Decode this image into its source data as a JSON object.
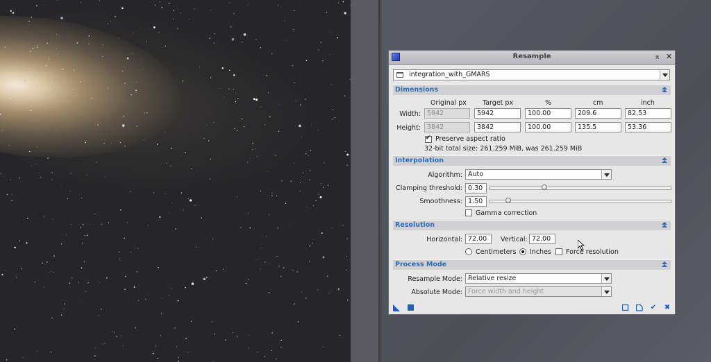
{
  "dialog": {
    "title": "Resample",
    "view_selector": "integration_with_GMARS"
  },
  "dimensions": {
    "header": "Dimensions",
    "columns": [
      "Original px",
      "Target px",
      "%",
      "cm",
      "inch"
    ],
    "width": {
      "label": "Width:",
      "original": "5942",
      "target": "5942",
      "percent": "100.00",
      "cm": "209.6",
      "inch": "82.53"
    },
    "height": {
      "label": "Height:",
      "original": "3842",
      "target": "3842",
      "percent": "100.00",
      "cm": "135.5",
      "inch": "53.36"
    },
    "preserve_label": "Preserve aspect ratio",
    "preserve_checked": true,
    "size_info": "32-bit total size: 261.259 MiB, was 261.259 MiB"
  },
  "interpolation": {
    "header": "Interpolation",
    "algorithm_label": "Algorithm:",
    "algorithm_value": "Auto",
    "clamping_label": "Clamping threshold:",
    "clamping_value": "0.30",
    "clamping_level": 0.3,
    "smoothness_label": "Smoothness:",
    "smoothness_value": "1.50",
    "smoothness_level": 0.1,
    "gamma_label": "Gamma correction",
    "gamma_checked": false
  },
  "resolution": {
    "header": "Resolution",
    "horizontal_label": "Horizontal:",
    "horizontal_value": "72.00",
    "vertical_label": "Vertical:",
    "vertical_value": "72.00",
    "unit_cm_label": "Centimeters",
    "unit_in_label": "Inches",
    "unit_selected": "Inches",
    "force_label": "Force resolution",
    "force_checked": false
  },
  "process_mode": {
    "header": "Process Mode",
    "resample_label": "Resample Mode:",
    "resample_value": "Relative resize",
    "absolute_label": "Absolute Mode:",
    "absolute_value": "Force width and height"
  },
  "colors": {
    "section_text": "#2a6ebb",
    "icon_blue": "#1f5fbf"
  },
  "icons": [
    "triangle-icon",
    "square-icon",
    "reset-icon",
    "new-instance-icon",
    "apply-icon",
    "apply-global-icon"
  ]
}
